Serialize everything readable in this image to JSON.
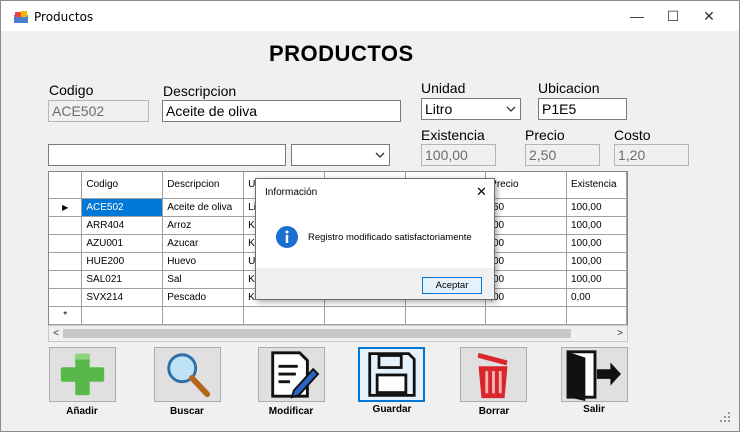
{
  "window": {
    "title": "Productos",
    "controls": {
      "minimize": "—",
      "maximize": "☐",
      "close": "✕"
    }
  },
  "heading": "PRODUCTOS",
  "form": {
    "codigo": {
      "label": "Codigo",
      "value": "ACE502"
    },
    "descripcion": {
      "label": "Descripcion",
      "value": "Aceite de oliva"
    },
    "unidad": {
      "label": "Unidad",
      "value": "Litro"
    },
    "ubicacion": {
      "label": "Ubicacion",
      "value": "P1E5"
    },
    "existencia": {
      "label": "Existencia",
      "value": "100,00"
    },
    "precio": {
      "label": "Precio",
      "value": "2,50"
    },
    "costo": {
      "label": "Costo",
      "value": "1,20"
    },
    "search": {
      "value": ""
    },
    "filter": {
      "value": ""
    }
  },
  "grid": {
    "columns": [
      "Codigo",
      "Descripcion",
      "U",
      "",
      "",
      "Precio",
      "Existencia"
    ],
    "rows": [
      [
        "ACE502",
        "Aceite de oliva",
        "Lit",
        "",
        "",
        ",50",
        "100,00"
      ],
      [
        "ARR404",
        "Arroz",
        "Kil",
        "",
        "",
        ",00",
        "100,00"
      ],
      [
        "AZU001",
        "Azucar",
        "Kil",
        "",
        "",
        ",00",
        "100,00"
      ],
      [
        "HUE200",
        "Huevo",
        "Ur",
        "",
        "",
        ",00",
        "100,00"
      ],
      [
        "SAL021",
        "Sal",
        "Kil",
        "",
        "",
        ",00",
        "100,00"
      ],
      [
        "SVX214",
        "Pescado",
        "Kil",
        "",
        "",
        ",00",
        "0,00"
      ]
    ],
    "current_row_marker": "▶",
    "new_row_marker": "*"
  },
  "dialog": {
    "title": "Información",
    "message": "Registro modificado satisfactoriamente",
    "ok_label": "Aceptar",
    "close": "✕"
  },
  "toolbar": {
    "add": "Añadir",
    "search": "Buscar",
    "edit": "Modificar",
    "save": "Guardar",
    "delete": "Borrar",
    "exit": "Salir"
  },
  "colors": {
    "accent": "#0078d7",
    "add_green": "#59b84a",
    "delete_red": "#d9262b"
  }
}
